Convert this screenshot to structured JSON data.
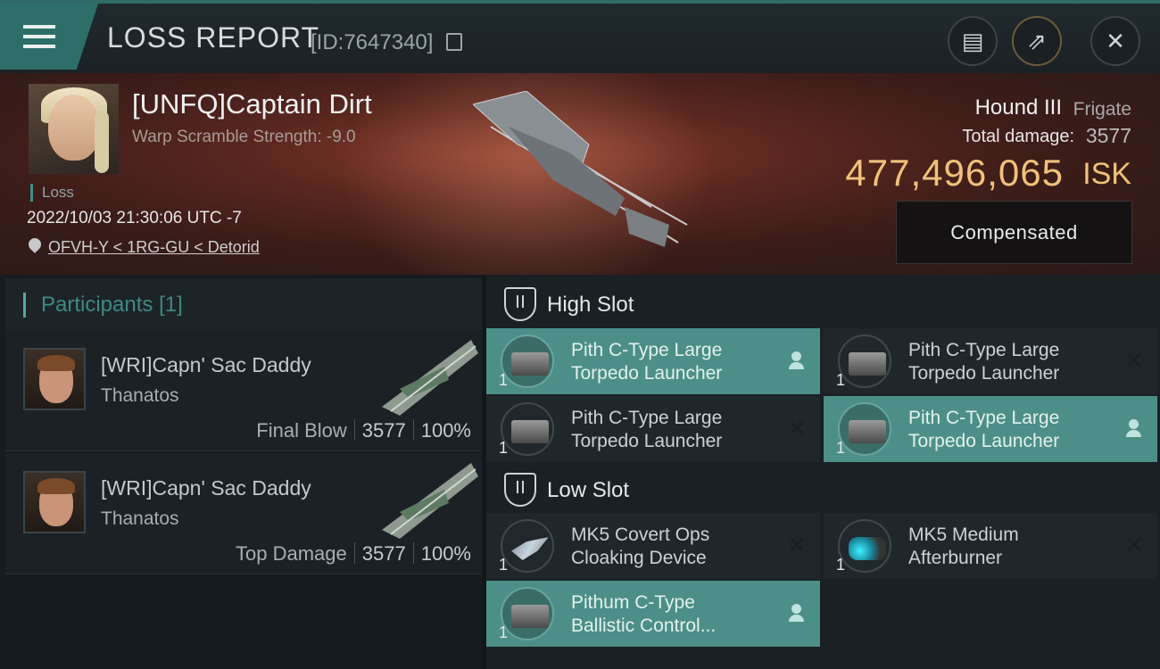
{
  "header": {
    "title": "LOSS REPORT",
    "report_id": "[ID:7647340]",
    "icons": [
      "menu-icon",
      "copy-icon",
      "clipboard-icon",
      "share-icon",
      "close-icon"
    ]
  },
  "victim": {
    "name": "[UNFQ]Captain Dirt",
    "scramble": "Warp Scramble Strength: -9.0",
    "status": "Loss",
    "datetime": "2022/10/03 21:30:06 UTC -7",
    "location": "OFVH-Y < 1RG-GU < Detorid",
    "ship_name": "Hound III",
    "ship_class": "Frigate",
    "total_damage_label": "Total damage:",
    "total_damage": "3577",
    "isk_value": "477,496,065",
    "isk_unit": "ISK",
    "compensated_label": "Compensated"
  },
  "participants": {
    "title": "Participants",
    "count": "[1]",
    "rows": [
      {
        "name": "[WRI]Capn' Sac Daddy",
        "ship": "Thanatos",
        "role": "Final Blow",
        "damage": "3577",
        "percent": "100%"
      },
      {
        "name": "[WRI]Capn' Sac Daddy",
        "ship": "Thanatos",
        "role": "Top Damage",
        "damage": "3577",
        "percent": "100%"
      }
    ]
  },
  "slots": {
    "high": {
      "title": "High Slot",
      "modules": [
        {
          "line1": "Pith C-Type Large",
          "line2": "Torpedo Launcher",
          "qty": "1",
          "state": "active"
        },
        {
          "line1": "Pith C-Type Large",
          "line2": "Torpedo Launcher",
          "qty": "1",
          "state": "destroyed"
        },
        {
          "line1": "Pith C-Type Large",
          "line2": "Torpedo Launcher",
          "qty": "1",
          "state": "destroyed"
        },
        {
          "line1": "Pith C-Type Large",
          "line2": "Torpedo Launcher",
          "qty": "1",
          "state": "active"
        }
      ]
    },
    "low": {
      "title": "Low Slot",
      "modules": [
        {
          "line1": "MK5 Covert Ops",
          "line2": "Cloaking Device",
          "qty": "1",
          "state": "destroyed"
        },
        {
          "line1": "MK5 Medium",
          "line2": "Afterburner",
          "qty": "1",
          "state": "destroyed"
        },
        {
          "line1": "Pithum C-Type",
          "line2": "Ballistic Control...",
          "qty": "1",
          "state": "active"
        }
      ]
    }
  }
}
